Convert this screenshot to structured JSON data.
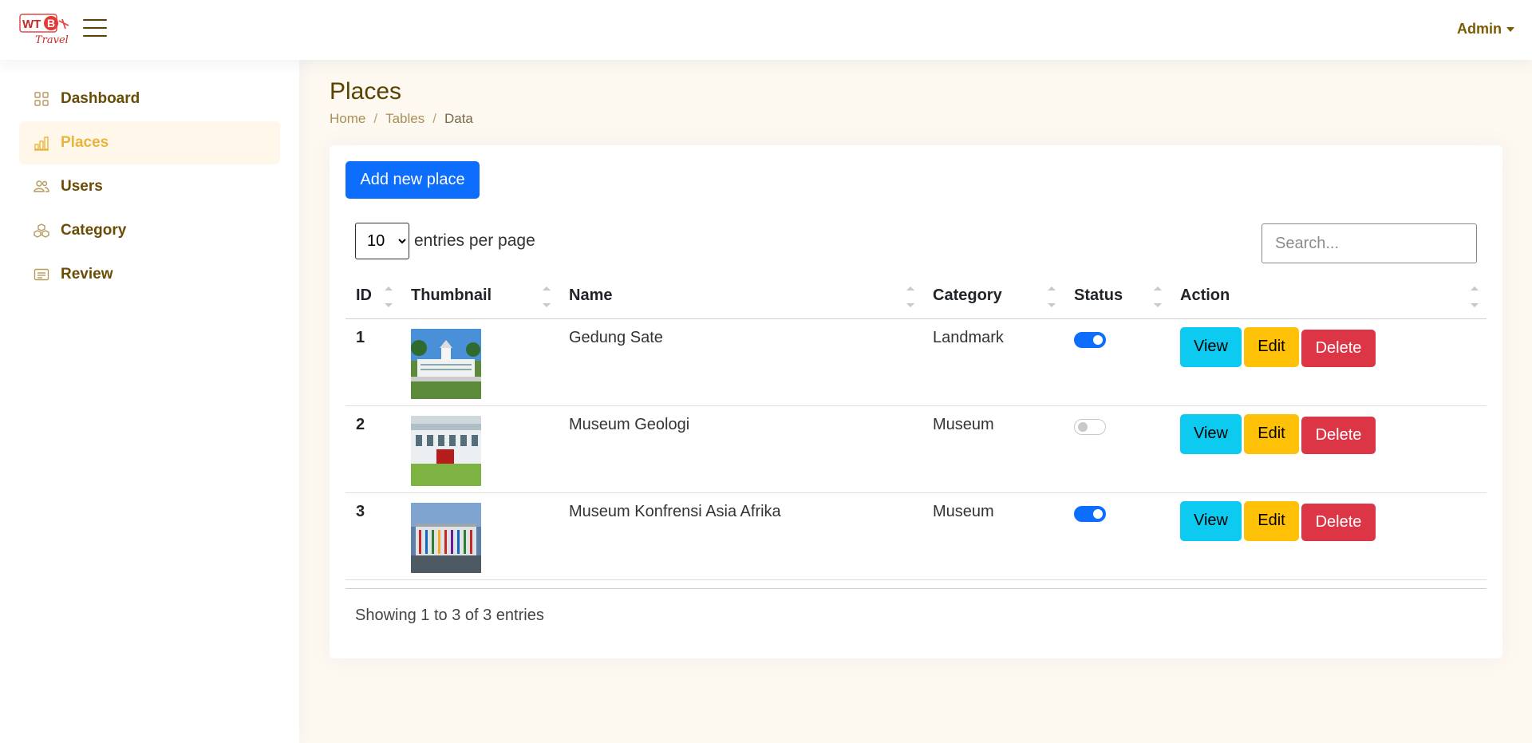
{
  "header": {
    "logo_text": "WTB Travel",
    "admin_label": "Admin"
  },
  "sidebar": {
    "items": [
      {
        "label": "Dashboard",
        "icon": "grid-icon",
        "active": false
      },
      {
        "label": "Places",
        "icon": "bar-chart-icon",
        "active": true
      },
      {
        "label": "Users",
        "icon": "users-icon",
        "active": false
      },
      {
        "label": "Category",
        "icon": "boxes-icon",
        "active": false
      },
      {
        "label": "Review",
        "icon": "card-text-icon",
        "active": false
      }
    ]
  },
  "page": {
    "title": "Places",
    "breadcrumb": [
      "Home",
      "Tables",
      "Data"
    ]
  },
  "toolbar": {
    "add_label": "Add new place",
    "per_page_value": "10",
    "per_page_label": "entries per page",
    "search_placeholder": "Search..."
  },
  "table": {
    "columns": [
      "ID",
      "Thumbnail",
      "Name",
      "Category",
      "Status",
      "Action"
    ],
    "rows": [
      {
        "id": "1",
        "name": "Gedung Sate",
        "category": "Landmark",
        "status": true
      },
      {
        "id": "2",
        "name": "Museum Geologi",
        "category": "Museum",
        "status": false
      },
      {
        "id": "3",
        "name": "Museum Konfrensi Asia Afrika",
        "category": "Museum",
        "status": true
      }
    ],
    "actions": {
      "view": "View",
      "edit": "Edit",
      "delete": "Delete"
    }
  },
  "footer": {
    "showing": "Showing 1 to 3 of 3 entries"
  },
  "colors": {
    "primary": "#0d6efd",
    "info": "#0dcaf0",
    "warning": "#ffc107",
    "danger": "#dc3545",
    "brand_brown": "#6a4d05",
    "active_gold": "#eab43c"
  }
}
